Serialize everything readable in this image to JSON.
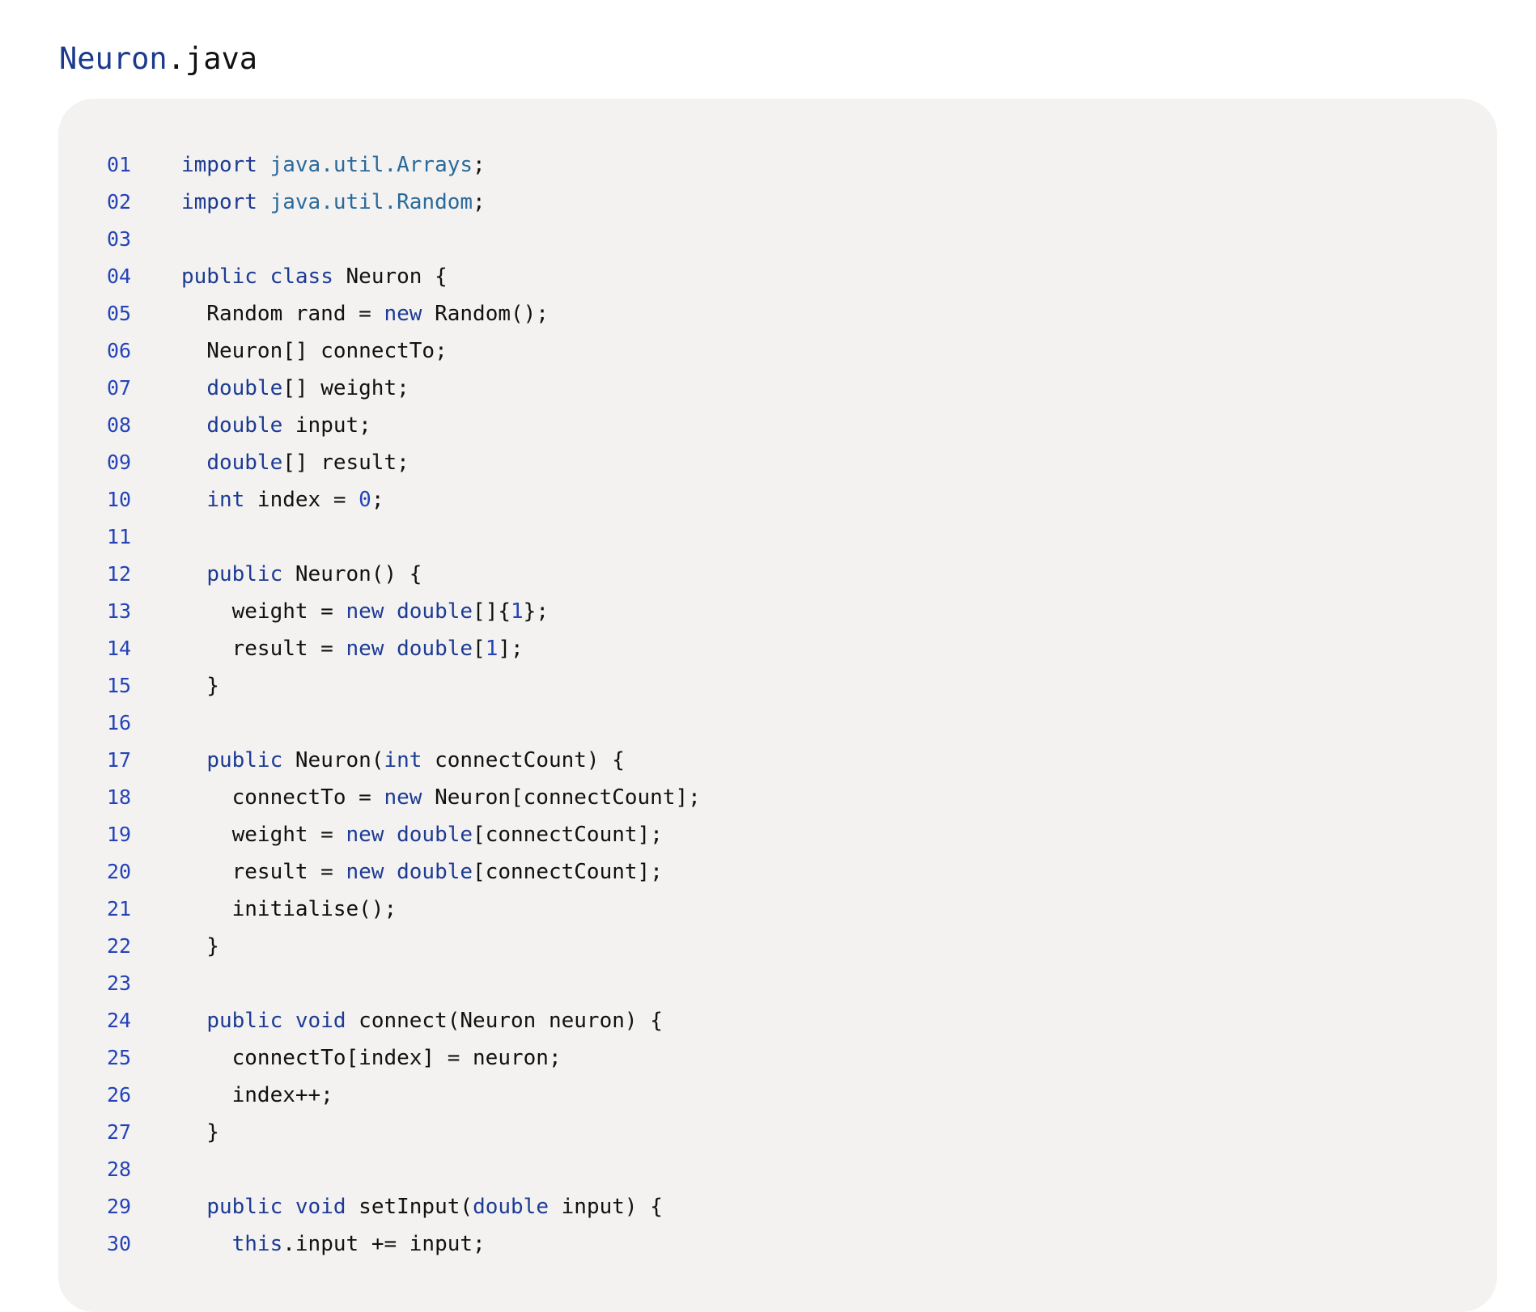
{
  "file": {
    "base": "Neuron",
    "ext": ".java"
  },
  "colors": {
    "keyword": "#1d3b93",
    "package": "#2a6a9a",
    "number": "#2443b8",
    "line_number": "#2443b8",
    "plain": "#111111",
    "panel_background": "#f3f2f1"
  },
  "code": {
    "lines": [
      {
        "num": "01",
        "tokens": [
          {
            "t": "import",
            "k": "kw"
          },
          {
            "t": " "
          },
          {
            "t": "java.util.Arrays",
            "k": "pkg"
          },
          {
            "t": ";"
          }
        ]
      },
      {
        "num": "02",
        "tokens": [
          {
            "t": "import",
            "k": "kw"
          },
          {
            "t": " "
          },
          {
            "t": "java.util.Random",
            "k": "pkg"
          },
          {
            "t": ";"
          }
        ]
      },
      {
        "num": "03",
        "tokens": []
      },
      {
        "num": "04",
        "tokens": [
          {
            "t": "public",
            "k": "kw"
          },
          {
            "t": " "
          },
          {
            "t": "class",
            "k": "kw"
          },
          {
            "t": " Neuron {"
          }
        ]
      },
      {
        "num": "05",
        "tokens": [
          {
            "t": "  Random rand = "
          },
          {
            "t": "new",
            "k": "kw"
          },
          {
            "t": " Random();"
          }
        ]
      },
      {
        "num": "06",
        "tokens": [
          {
            "t": "  Neuron[] connectTo;"
          }
        ]
      },
      {
        "num": "07",
        "tokens": [
          {
            "t": "  "
          },
          {
            "t": "double",
            "k": "kw"
          },
          {
            "t": "[] weight;"
          }
        ]
      },
      {
        "num": "08",
        "tokens": [
          {
            "t": "  "
          },
          {
            "t": "double",
            "k": "kw"
          },
          {
            "t": " input;"
          }
        ]
      },
      {
        "num": "09",
        "tokens": [
          {
            "t": "  "
          },
          {
            "t": "double",
            "k": "kw"
          },
          {
            "t": "[] result;"
          }
        ]
      },
      {
        "num": "10",
        "tokens": [
          {
            "t": "  "
          },
          {
            "t": "int",
            "k": "kw"
          },
          {
            "t": " index = "
          },
          {
            "t": "0",
            "k": "num"
          },
          {
            "t": ";"
          }
        ]
      },
      {
        "num": "11",
        "tokens": []
      },
      {
        "num": "12",
        "tokens": [
          {
            "t": "  "
          },
          {
            "t": "public",
            "k": "kw"
          },
          {
            "t": " Neuron() {"
          }
        ]
      },
      {
        "num": "13",
        "tokens": [
          {
            "t": "    weight = "
          },
          {
            "t": "new",
            "k": "kw"
          },
          {
            "t": " "
          },
          {
            "t": "double",
            "k": "kw"
          },
          {
            "t": "[]{"
          },
          {
            "t": "1",
            "k": "num"
          },
          {
            "t": "};"
          }
        ]
      },
      {
        "num": "14",
        "tokens": [
          {
            "t": "    result = "
          },
          {
            "t": "new",
            "k": "kw"
          },
          {
            "t": " "
          },
          {
            "t": "double",
            "k": "kw"
          },
          {
            "t": "["
          },
          {
            "t": "1",
            "k": "num"
          },
          {
            "t": "];"
          }
        ]
      },
      {
        "num": "15",
        "tokens": [
          {
            "t": "  }"
          }
        ]
      },
      {
        "num": "16",
        "tokens": []
      },
      {
        "num": "17",
        "tokens": [
          {
            "t": "  "
          },
          {
            "t": "public",
            "k": "kw"
          },
          {
            "t": " Neuron("
          },
          {
            "t": "int",
            "k": "kw"
          },
          {
            "t": " connectCount) {"
          }
        ]
      },
      {
        "num": "18",
        "tokens": [
          {
            "t": "    connectTo = "
          },
          {
            "t": "new",
            "k": "kw"
          },
          {
            "t": " Neuron[connectCount];"
          }
        ]
      },
      {
        "num": "19",
        "tokens": [
          {
            "t": "    weight = "
          },
          {
            "t": "new",
            "k": "kw"
          },
          {
            "t": " "
          },
          {
            "t": "double",
            "k": "kw"
          },
          {
            "t": "[connectCount];"
          }
        ]
      },
      {
        "num": "20",
        "tokens": [
          {
            "t": "    result = "
          },
          {
            "t": "new",
            "k": "kw"
          },
          {
            "t": " "
          },
          {
            "t": "double",
            "k": "kw"
          },
          {
            "t": "[connectCount];"
          }
        ]
      },
      {
        "num": "21",
        "tokens": [
          {
            "t": "    initialise();"
          }
        ]
      },
      {
        "num": "22",
        "tokens": [
          {
            "t": "  }"
          }
        ]
      },
      {
        "num": "23",
        "tokens": []
      },
      {
        "num": "24",
        "tokens": [
          {
            "t": "  "
          },
          {
            "t": "public",
            "k": "kw"
          },
          {
            "t": " "
          },
          {
            "t": "void",
            "k": "kw"
          },
          {
            "t": " connect(Neuron neuron) {"
          }
        ]
      },
      {
        "num": "25",
        "tokens": [
          {
            "t": "    connectTo[index] = neuron;"
          }
        ]
      },
      {
        "num": "26",
        "tokens": [
          {
            "t": "    index++;"
          }
        ]
      },
      {
        "num": "27",
        "tokens": [
          {
            "t": "  }"
          }
        ]
      },
      {
        "num": "28",
        "tokens": []
      },
      {
        "num": "29",
        "tokens": [
          {
            "t": "  "
          },
          {
            "t": "public",
            "k": "kw"
          },
          {
            "t": " "
          },
          {
            "t": "void",
            "k": "kw"
          },
          {
            "t": " setInput("
          },
          {
            "t": "double",
            "k": "kw"
          },
          {
            "t": " input) {"
          }
        ]
      },
      {
        "num": "30",
        "tokens": [
          {
            "t": "    "
          },
          {
            "t": "this",
            "k": "kw"
          },
          {
            "t": ".input += input;"
          }
        ]
      }
    ]
  }
}
